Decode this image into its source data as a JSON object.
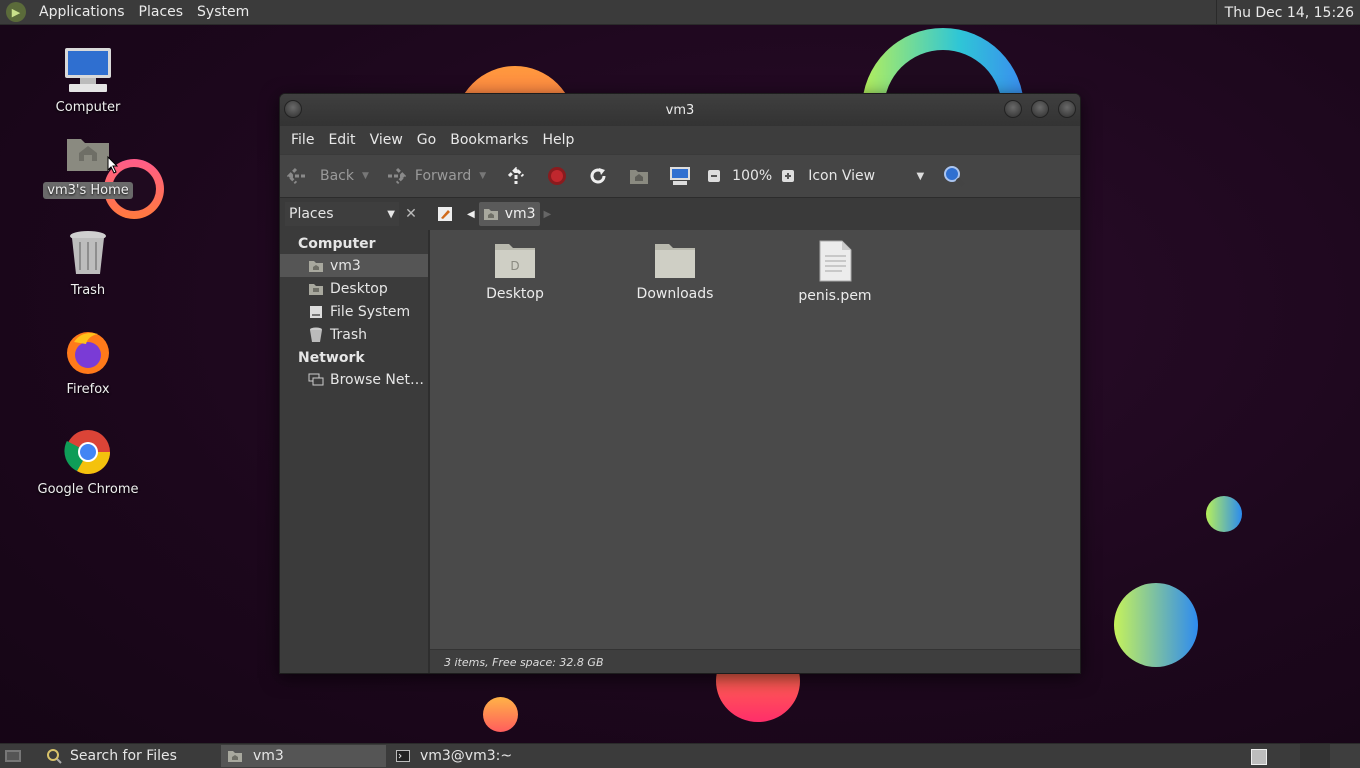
{
  "top_panel": {
    "menus": [
      "Applications",
      "Places",
      "System"
    ],
    "clock": "Thu Dec 14, 15:26"
  },
  "desktop": {
    "icons": [
      {
        "label": "Computer",
        "icon": "computer-icon"
      },
      {
        "label": "vm3's Home",
        "icon": "home-folder-icon"
      },
      {
        "label": "Trash",
        "icon": "trash-icon"
      },
      {
        "label": "Firefox",
        "icon": "firefox-icon"
      },
      {
        "label": "Google Chrome",
        "icon": "chrome-icon"
      }
    ]
  },
  "window": {
    "title": "vm3",
    "menu": [
      "File",
      "Edit",
      "View",
      "Go",
      "Bookmarks",
      "Help"
    ],
    "toolbar": {
      "back_label": "Back",
      "forward_label": "Forward",
      "zoom": "100%",
      "view_mode": "Icon View"
    },
    "location": {
      "places_label": "Places",
      "current": "vm3"
    },
    "sidebar": {
      "computer_heading": "Computer",
      "computer_items": [
        "vm3",
        "Desktop",
        "File System",
        "Trash"
      ],
      "network_heading": "Network",
      "network_items": [
        "Browse Net…"
      ]
    },
    "files": [
      {
        "name": "Desktop",
        "type": "folder"
      },
      {
        "name": "Downloads",
        "type": "folder"
      },
      {
        "name": "penis.pem",
        "type": "file"
      }
    ],
    "status": "3 items, Free space: 32.8 GB"
  },
  "bottom_panel": {
    "search_label": "Search for Files",
    "tasks": [
      "vm3",
      "vm3@vm3:~"
    ]
  },
  "colors": {
    "panel": "#3b3b3b",
    "window_bg": "#3d3d3d",
    "content_bg": "#4a4a4a",
    "stop": "#c0272d"
  }
}
